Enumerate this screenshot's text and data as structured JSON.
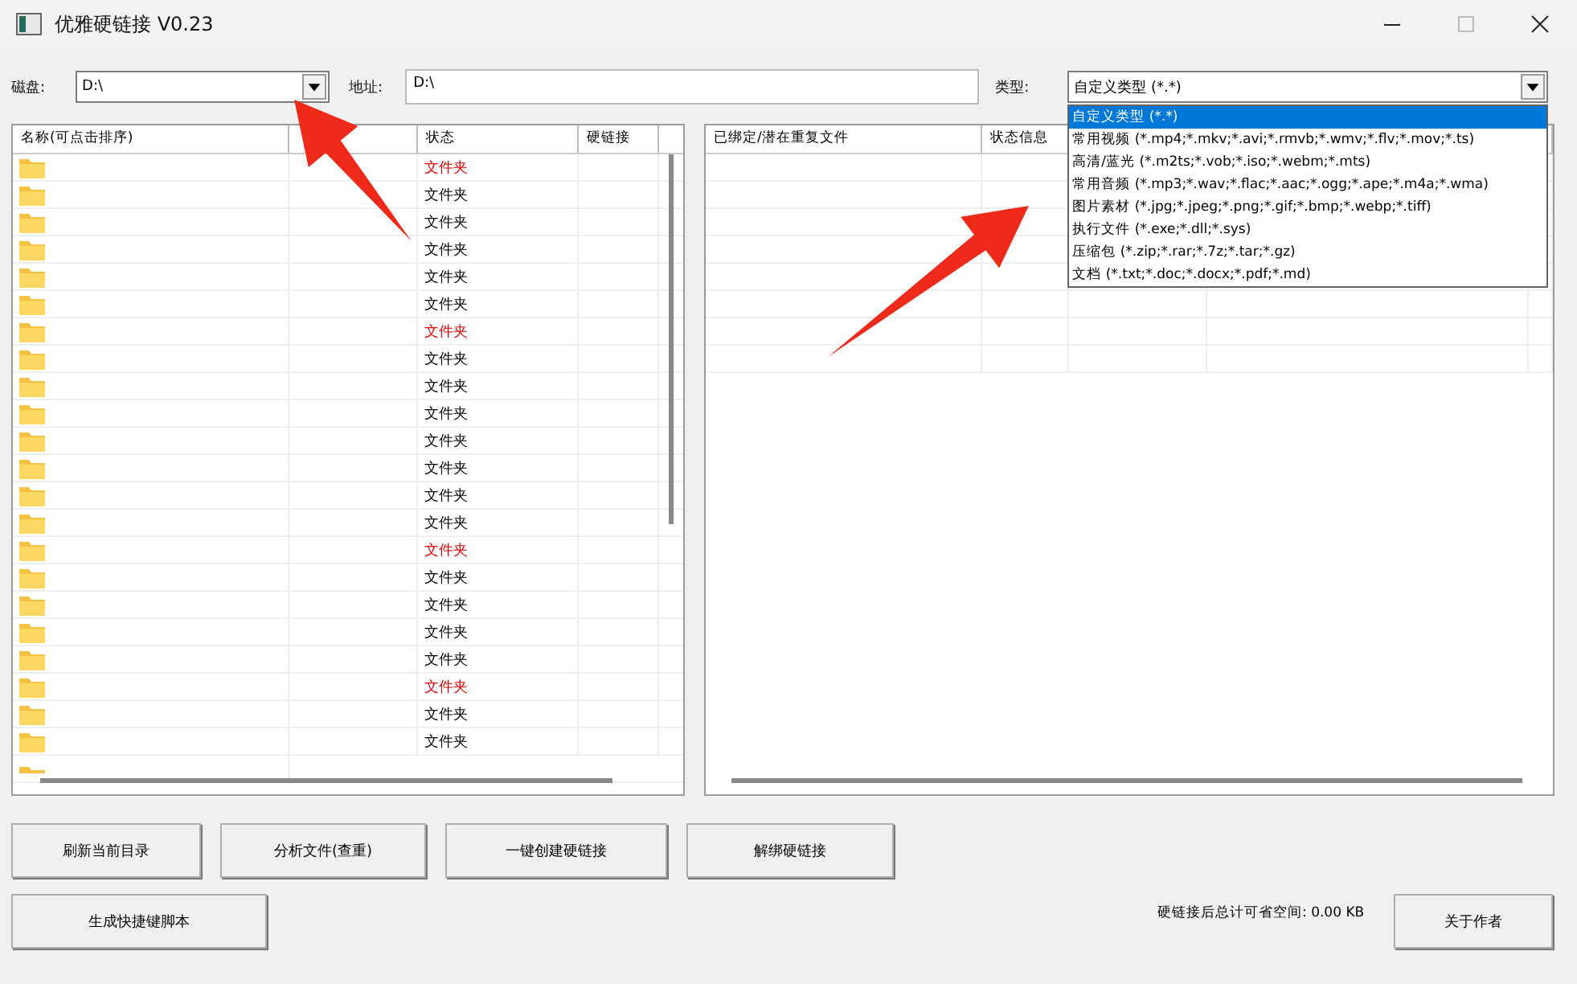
{
  "window": {
    "title": "优雅硬链接 V0.23"
  },
  "toolbar": {
    "disk_label": "磁盘:",
    "disk_value": "D:\\",
    "address_label": "地址:",
    "address_value": "D:\\",
    "type_label": "类型:",
    "type_value": "自定义类型 (*.*)"
  },
  "type_dropdown": {
    "expanded": true,
    "options": [
      {
        "label": "自定义类型 (*.*)",
        "selected": true
      },
      {
        "label": "常用视频 (*.mp4;*.mkv;*.avi;*.rmvb;*.wmv;*.flv;*.mov;*.ts)",
        "selected": false
      },
      {
        "label": "高清/蓝光 (*.m2ts;*.vob;*.iso;*.webm;*.mts)",
        "selected": false
      },
      {
        "label": "常用音频 (*.mp3;*.wav;*.flac;*.aac;*.ogg;*.ape;*.m4a;*.wma)",
        "selected": false
      },
      {
        "label": "图片素材 (*.jpg;*.jpeg;*.png;*.gif;*.bmp;*.webp;*.tiff)",
        "selected": false
      },
      {
        "label": "执行文件 (*.exe;*.dll;*.sys)",
        "selected": false
      },
      {
        "label": "压缩包 (*.zip;*.rar;*.7z;*.tar;*.gz)",
        "selected": false
      },
      {
        "label": "文档 (*.txt;*.doc;*.docx;*.pdf;*.md)",
        "selected": false
      }
    ]
  },
  "file_table": {
    "columns": [
      "名称(可点击排序)",
      "状态",
      "硬链接"
    ],
    "rows": [
      {
        "status": "文件夹",
        "color": "#e00000"
      },
      {
        "status": "文件夹",
        "color": "#000000"
      },
      {
        "status": "文件夹",
        "color": "#000000"
      },
      {
        "status": "文件夹",
        "color": "#000000"
      },
      {
        "status": "文件夹",
        "color": "#000000"
      },
      {
        "status": "文件夹",
        "color": "#000000"
      },
      {
        "status": "文件夹",
        "color": "#e00000"
      },
      {
        "status": "文件夹",
        "color": "#000000"
      },
      {
        "status": "文件夹",
        "color": "#000000"
      },
      {
        "status": "文件夹",
        "color": "#000000"
      },
      {
        "status": "文件夹",
        "color": "#000000"
      },
      {
        "status": "文件夹",
        "color": "#000000"
      },
      {
        "status": "文件夹",
        "color": "#000000"
      },
      {
        "status": "文件夹",
        "color": "#000000"
      },
      {
        "status": "文件夹",
        "color": "#e00000"
      },
      {
        "status": "文件夹",
        "color": "#000000"
      },
      {
        "status": "文件夹",
        "color": "#000000"
      },
      {
        "status": "文件夹",
        "color": "#000000"
      },
      {
        "status": "文件夹",
        "color": "#000000"
      },
      {
        "status": "文件夹",
        "color": "#e00000"
      },
      {
        "status": "文件夹",
        "color": "#000000"
      },
      {
        "status": "文件夹",
        "color": "#000000"
      }
    ]
  },
  "duplicate_table": {
    "columns": [
      "已绑定/潜在重复文件",
      "状态信息"
    ]
  },
  "buttons": [
    "刷新当前目录",
    "分析文件(查重)",
    "一键创建硬链接",
    "解绑硬链接"
  ],
  "script_button": "生成快捷键脚本",
  "savings_label": "硬链接后总计可省空间: 0.00 KB",
  "about_button": "关于作者"
}
